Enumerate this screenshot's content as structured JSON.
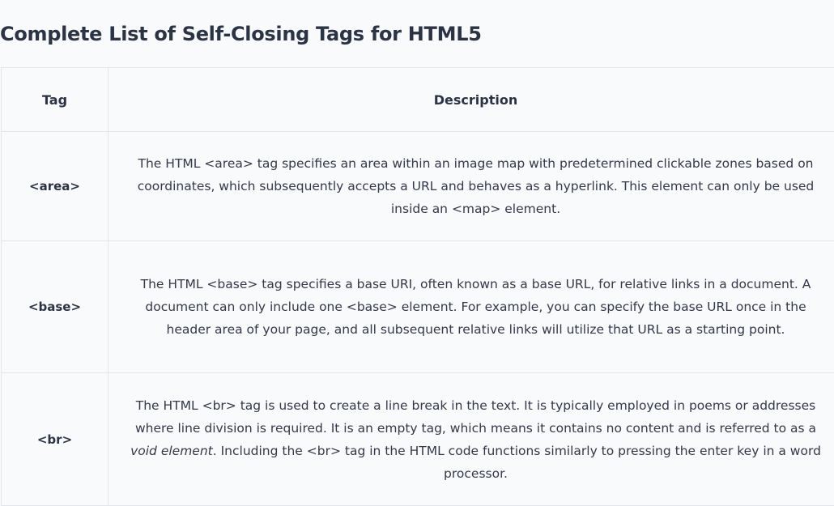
{
  "heading": "Complete List of Self-Closing Tags for HTML5",
  "table": {
    "headers": {
      "tag": "Tag",
      "description": "Description"
    },
    "rows": [
      {
        "tag": "<area>",
        "description": "The HTML <area> tag specifies an area within an image map with predetermined clickable zones based on coordinates, which subsequently accepts a URL and behaves as a hyperlink. This element can only be used inside an <map> element."
      },
      {
        "tag": "<base>",
        "description": "The HTML <base> tag specifies a base URI, often known as a base URL, for relative links in a document. A document can only include one <base> element. For example, you can specify the base URL once in the header area of your page, and all subsequent relative links will utilize that URL as a starting point."
      },
      {
        "tag": "<br>",
        "description_before": "The HTML <br> tag is used to create a line break in the text. It is typically employed in poems or addresses where line division is required. It is an empty tag, which means it contains no content and is referred to as a ",
        "description_em": "void element",
        "description_after": ". Including the <br> tag in the HTML code functions similarly to pressing the enter key in a word processor."
      }
    ]
  }
}
